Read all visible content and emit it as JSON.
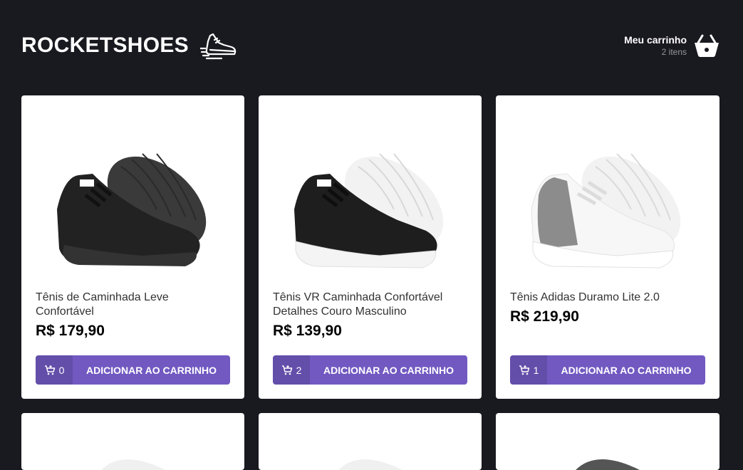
{
  "header": {
    "logo_text": "ROCKETSHOES",
    "logo_icon": "running-shoe-icon",
    "cart_title": "Meu carrinho",
    "cart_count": "2 itens",
    "cart_icon": "shopping-basket-icon"
  },
  "colors": {
    "background": "#191920",
    "card": "#ffffff",
    "accent": "#7159c1"
  },
  "products": [
    {
      "title": "Tênis de Caminhada Leve Confortável",
      "price": "R$ 179,90",
      "amount": "0",
      "button_label": "ADICIONAR AO CARRINHO",
      "shoe_style": "all-black"
    },
    {
      "title": "Tênis VR Caminhada Confortável Detalhes Couro Masculino",
      "price": "R$ 139,90",
      "amount": "2",
      "button_label": "ADICIONAR AO CARRINHO",
      "shoe_style": "black-white-sole"
    },
    {
      "title": "Tênis Adidas Duramo Lite 2.0",
      "price": "R$ 219,90",
      "amount": "1",
      "button_label": "ADICIONAR AO CARRINHO",
      "shoe_style": "white-grey"
    }
  ]
}
